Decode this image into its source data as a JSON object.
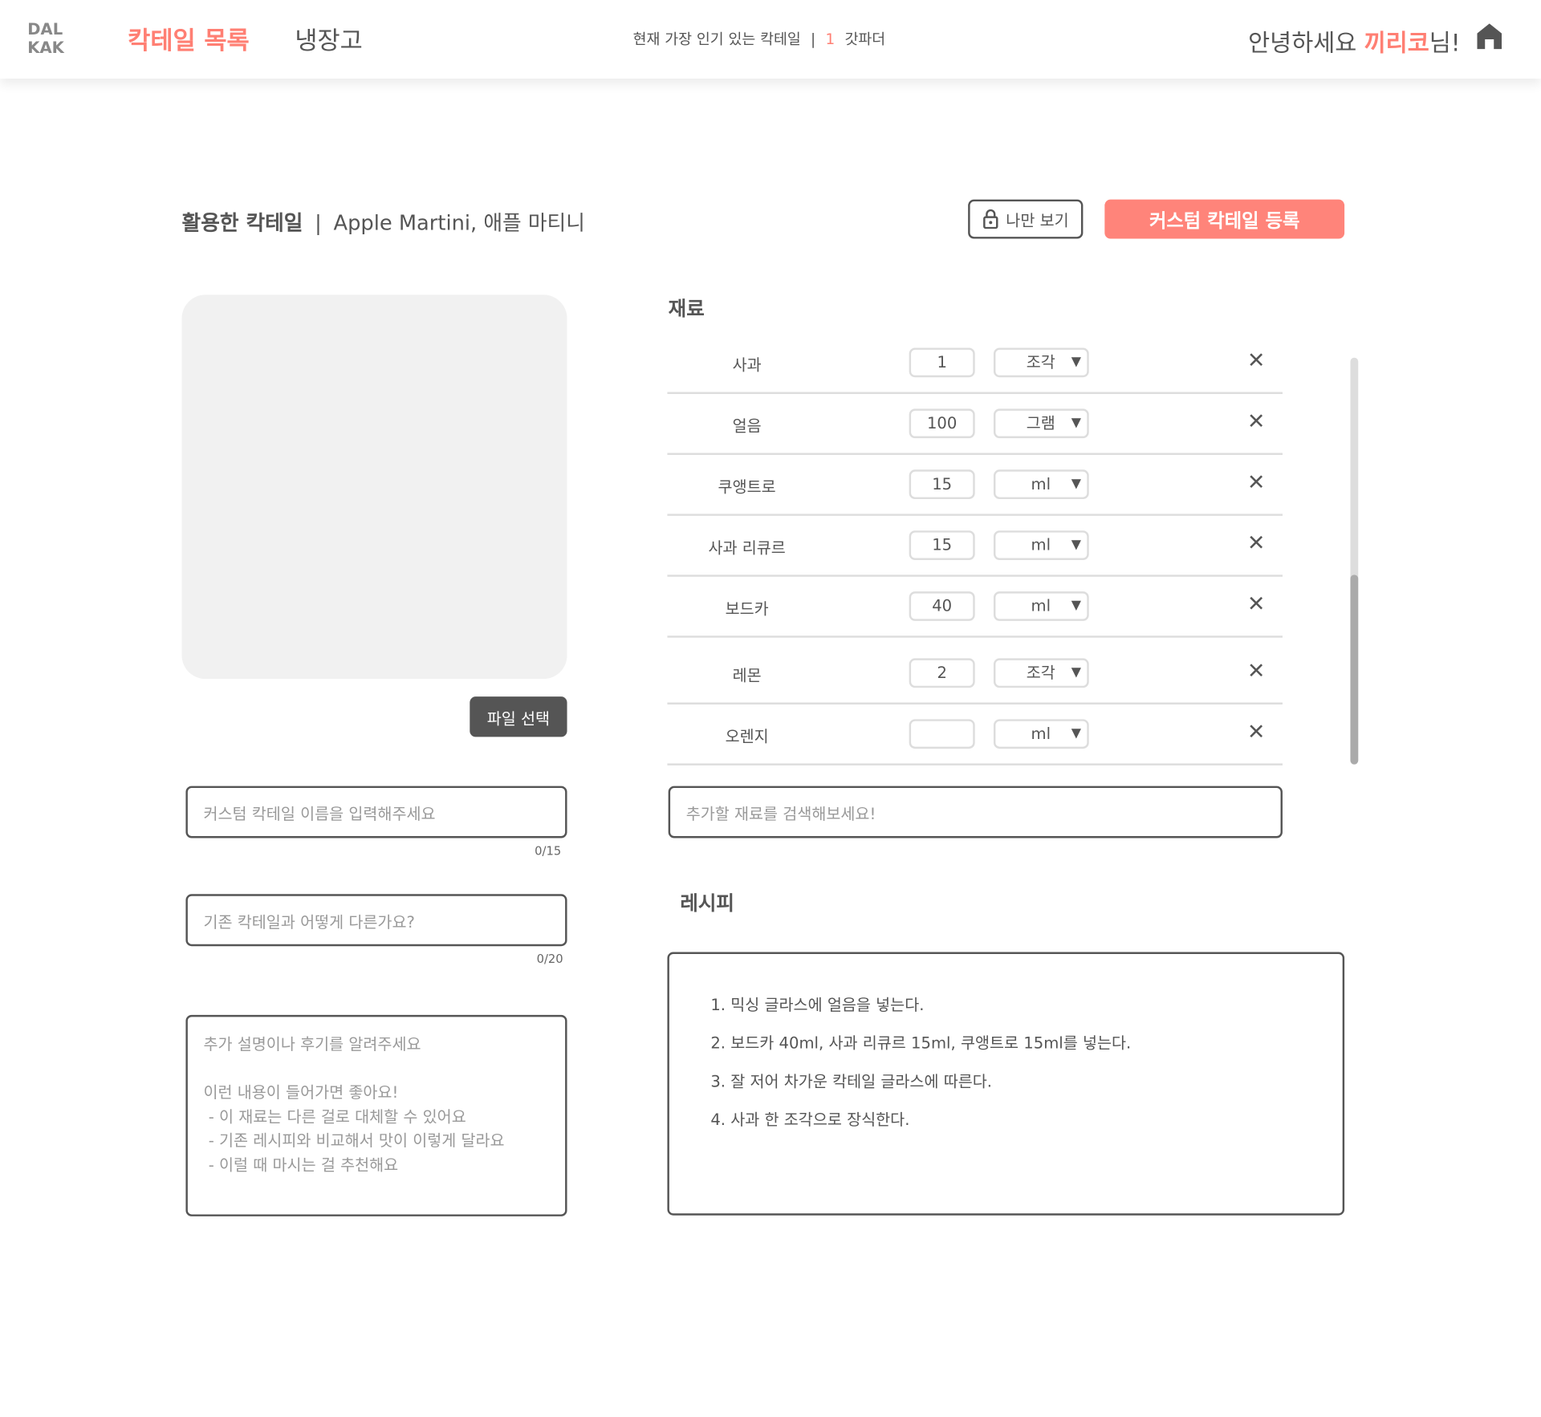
{
  "header": {
    "logo": [
      "DAL",
      "KAK"
    ],
    "nav": [
      {
        "label": "칵테일 목록",
        "active": true
      },
      {
        "label": "냉장고",
        "active": false
      }
    ],
    "popular": {
      "label": "현재 가장 인기 있는 칵테일",
      "rank": "1",
      "name": "갓파더"
    },
    "greeting": {
      "prefix": "안녕하세요 ",
      "user": "끼리코",
      "suffix": "님!"
    },
    "home_icon": "home-icon"
  },
  "title": {
    "label": "활용한 칵테일",
    "separator": "|",
    "cocktail": "Apple Martini, 애플 마티니"
  },
  "private_button": {
    "label": "나만 보기",
    "icon": "lock-icon"
  },
  "register_button": "커스텀 칵테일 등록",
  "file_button": "파일 선택",
  "name_input": {
    "value": "",
    "placeholder": "커스텀 칵테일 이름을 입력해주세요",
    "counter": "0/15"
  },
  "diff_input": {
    "value": "",
    "placeholder": "기존 칵테일과 어떻게 다른가요?",
    "counter": "0/20"
  },
  "description": {
    "placeholder_lines": [
      "추가 설명이나 후기를 알려주세요",
      "",
      "이런 내용이 들어가면 좋아요!",
      " - 이 재료는 다른 걸로 대체할 수 있어요",
      " - 기존 레시피와 비교해서 맛이 이렇게 달라요",
      " - 이럴 때 마시는 걸 추천해요"
    ]
  },
  "ingredients": {
    "heading": "재료",
    "items": [
      {
        "name": "사과",
        "qty": "1",
        "unit": "조각"
      },
      {
        "name": "얼음",
        "qty": "100",
        "unit": "그램"
      },
      {
        "name": "쿠앵트로",
        "qty": "15",
        "unit": "ml"
      },
      {
        "name": "사과 리큐르",
        "qty": "15",
        "unit": "ml"
      },
      {
        "name": "보드카",
        "qty": "40",
        "unit": "ml"
      },
      {
        "name": "레몬",
        "qty": "2",
        "unit": "조각"
      },
      {
        "name": "오렌지",
        "qty": "",
        "unit": "ml"
      }
    ],
    "remove_symbol": "✕",
    "dropdown_symbol": "▼",
    "search": {
      "value": "",
      "placeholder": "추가할 재료를 검색해보세요!"
    }
  },
  "recipe": {
    "heading": "레시피",
    "steps": [
      "1. 믹싱 글라스에 얼음을 넣는다.",
      "2. 보드카 40ml, 사과 리큐르 15ml, 쿠앵트로 15ml를 넣는다.",
      "3. 잘 저어 차가운 칵테일 글라스에 따른다.",
      "4. 사과 한 조각으로 장식한다."
    ]
  },
  "colors": {
    "accent": "#ff7f73",
    "button_dark": "#555555",
    "placeholder_bg": "#f1f1f1"
  }
}
